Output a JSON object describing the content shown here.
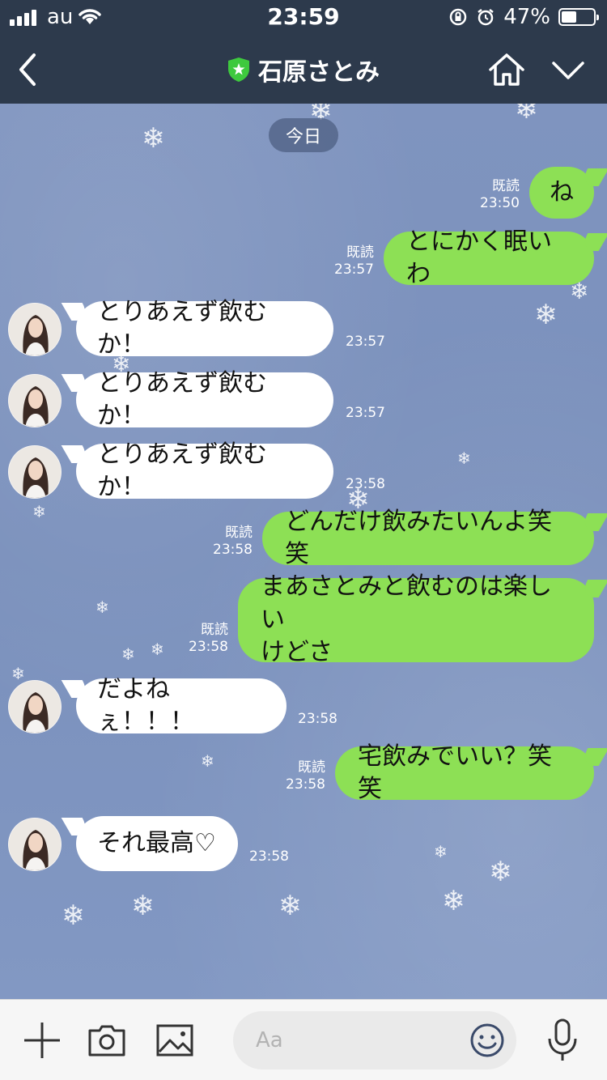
{
  "status_bar": {
    "carrier": "au",
    "time": "23:59",
    "battery_percent_label": "47%",
    "battery_level": 0.47
  },
  "header": {
    "title": "石原さとみ",
    "verified_badge_icon": "shield-star-icon",
    "back_icon": "chevron-left-icon",
    "home_icon": "home-icon",
    "menu_icon": "chevron-down-icon"
  },
  "chat": {
    "date_separator": "今日",
    "read_label": "既読",
    "messages": [
      {
        "side": "out",
        "text": "ね",
        "time": "23:50",
        "read": true
      },
      {
        "side": "out",
        "text": "とにかく眠いわ",
        "time": "23:57",
        "read": true
      },
      {
        "side": "in",
        "text": "とりあえず飲むか！",
        "time": "23:57"
      },
      {
        "side": "in",
        "text": "とりあえず飲むか！",
        "time": "23:57"
      },
      {
        "side": "in",
        "text": "とりあえず飲むか！",
        "time": "23:58"
      },
      {
        "side": "out",
        "text": "どんだけ飲みたいんよ笑笑",
        "time": "23:58",
        "read": true
      },
      {
        "side": "out",
        "text": "まあさとみと飲むのは楽しいけどさ",
        "line1": "まあさとみと飲むのは楽しい",
        "line2": "けどさ",
        "time": "23:58",
        "read": true
      },
      {
        "side": "in",
        "text": "だよねぇ！！！",
        "time": "23:58"
      },
      {
        "side": "out",
        "text": "宅飲みでいい？笑笑",
        "time": "23:58",
        "read": true
      },
      {
        "side": "in",
        "text": "それ最高♡",
        "time": "23:58"
      }
    ]
  },
  "bottom_bar": {
    "input_placeholder": "Aa",
    "icons": [
      "plus-icon",
      "camera-icon",
      "image-icon",
      "smile-icon",
      "microphone-icon"
    ]
  },
  "colors": {
    "header_bg": "#2d3a4c",
    "outgoing_bubble": "#8de055",
    "incoming_bubble": "#ffffff",
    "chat_bg": "#7f94bf",
    "verified_badge": "#3ec93e"
  }
}
